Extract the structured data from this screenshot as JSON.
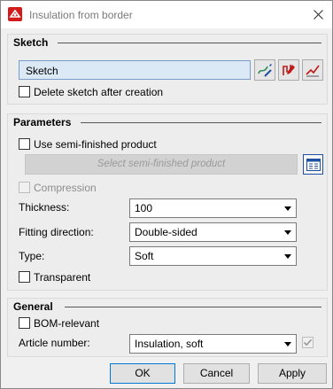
{
  "window": {
    "title": "Insulation from border"
  },
  "sketch": {
    "heading": "Sketch",
    "field_value": "Sketch",
    "delete_label": "Delete sketch after creation",
    "delete_checked": false
  },
  "parameters": {
    "heading": "Parameters",
    "semi_finished_label": "Use semi-finished product",
    "select_button": "Select semi-finished product",
    "compression_label": "Compression",
    "thickness_label": "Thickness:",
    "thickness_value": "100",
    "fitting_label": "Fitting direction:",
    "fitting_value": "Double-sided",
    "type_label": "Type:",
    "type_value": "Soft",
    "transparent_label": "Transparent"
  },
  "general": {
    "heading": "General",
    "bom_label": "BOM-relevant",
    "article_label": "Article number:",
    "article_value": "Insulation, soft"
  },
  "buttons": {
    "ok": "OK",
    "cancel": "Cancel",
    "apply": "Apply"
  },
  "icons": {
    "app": "hicad-app-icon",
    "close": "close-icon",
    "pick": "pick-sketch-icon",
    "edit": "edit-sketch-icon",
    "profile": "profile-icon",
    "catalog": "catalog-icon"
  },
  "colors": {
    "accent": "#0078d7",
    "field_bg": "#dbe8f6",
    "app_red": "#d21c1c"
  }
}
